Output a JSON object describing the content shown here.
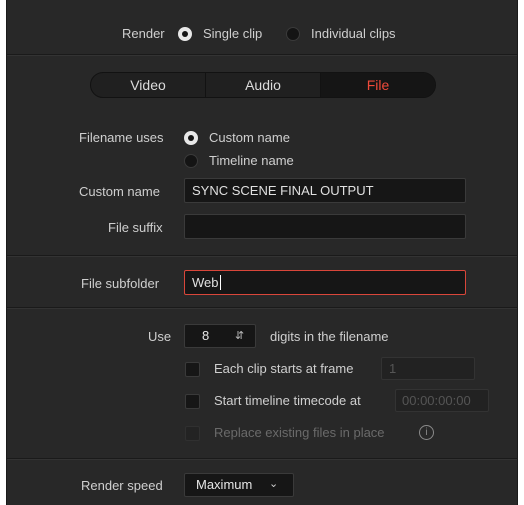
{
  "render": {
    "label": "Render",
    "options": [
      "Single clip",
      "Individual clips"
    ],
    "selected": "Single clip"
  },
  "tabs": [
    {
      "label": "Video",
      "active": false
    },
    {
      "label": "Audio",
      "active": false
    },
    {
      "label": "File",
      "active": true
    }
  ],
  "accent_color": "#f04a3a",
  "filename": {
    "label": "Filename uses",
    "options": [
      "Custom name",
      "Timeline name"
    ],
    "selected": "Custom name"
  },
  "custom_name": {
    "label": "Custom name",
    "value": "SYNC SCENE FINAL OUTPUT"
  },
  "file_suffix": {
    "label": "File suffix",
    "value": ""
  },
  "file_subfolder": {
    "label": "File subfolder",
    "value": "Web"
  },
  "digits": {
    "use_label": "Use",
    "value": "8",
    "suffix_label": "digits in the filename"
  },
  "each_clip": {
    "label": "Each clip starts at frame",
    "checked": false,
    "placeholder": "1"
  },
  "start_timecode": {
    "label": "Start timeline timecode at",
    "checked": false,
    "placeholder": "00:00:00:00"
  },
  "replace_existing": {
    "label": "Replace existing files in place",
    "checked": false,
    "enabled": false
  },
  "render_speed": {
    "label": "Render speed",
    "value": "Maximum"
  }
}
